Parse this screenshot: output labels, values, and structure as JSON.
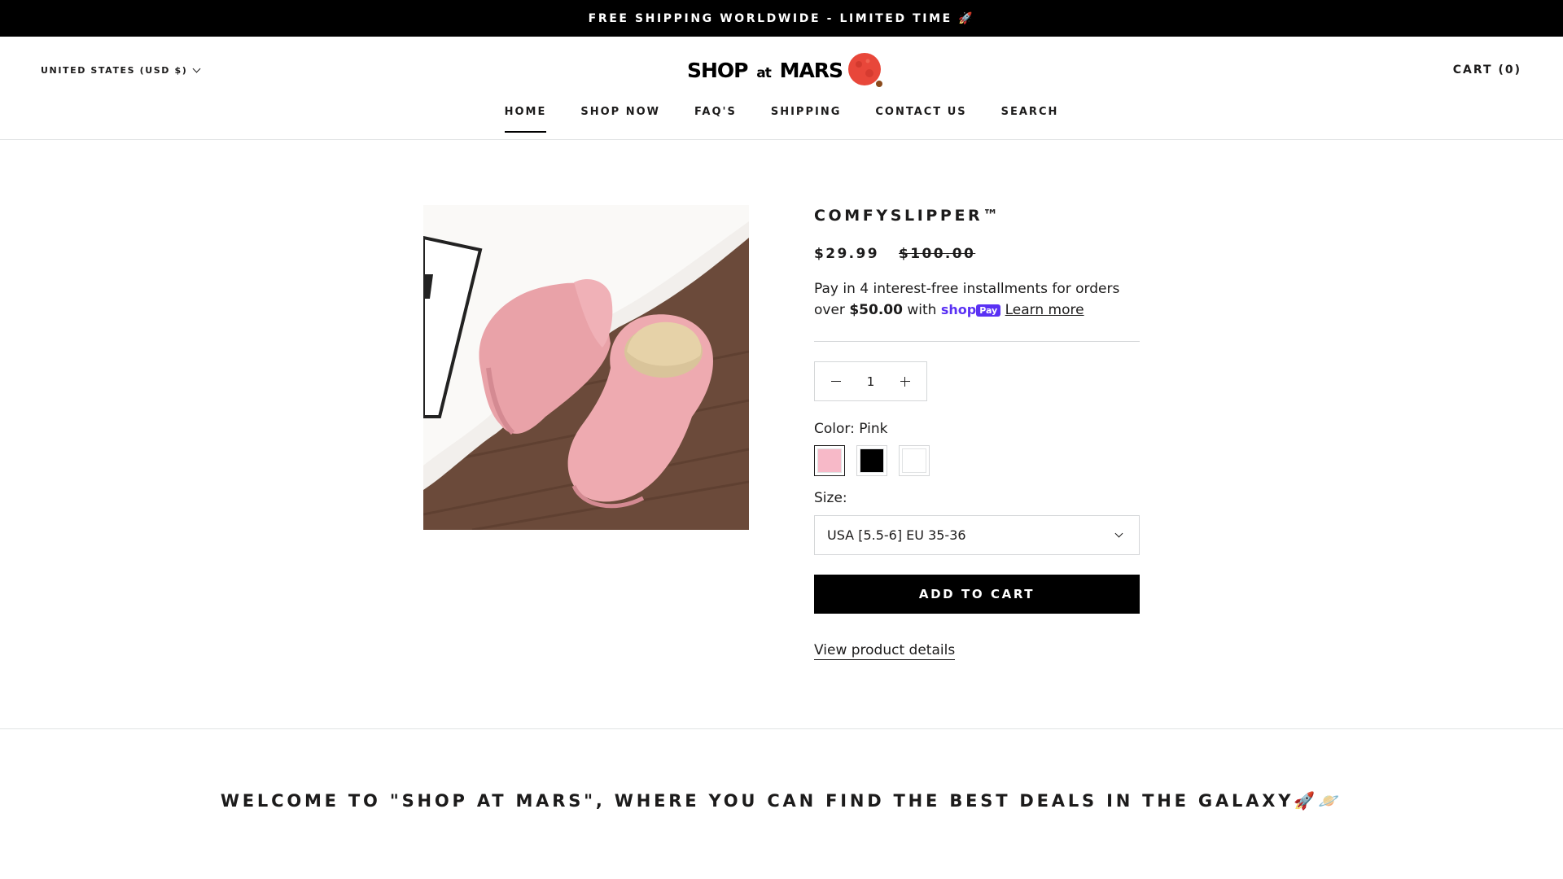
{
  "announcement": {
    "text": "FREE SHIPPING WORLDWIDE - LIMITED TIME 🚀"
  },
  "header": {
    "country": "UNITED STATES (USD $)",
    "logo_main": "SHOP",
    "logo_at": "at",
    "logo_end": "MARS",
    "cart": "CART (0)"
  },
  "nav": {
    "items": [
      {
        "label": "HOME",
        "active": true
      },
      {
        "label": "SHOP NOW"
      },
      {
        "label": "FAQ'S"
      },
      {
        "label": "SHIPPING"
      },
      {
        "label": "CONTACT US"
      },
      {
        "label": "SEARCH"
      }
    ]
  },
  "product": {
    "title": "COMFYSLIPPER™",
    "price": "$29.99",
    "compare_price": "$100.00",
    "installments_prefix": "Pay in 4 interest-free installments for orders over",
    "installments_amount": "$50.00",
    "installments_with": "with",
    "shoppay_word": "shop",
    "shoppay_badge": "Pay",
    "learn_more": "Learn more",
    "quantity": "1",
    "color_label": "Color: Pink",
    "colors": [
      {
        "name": "Pink",
        "hex": "#f7b9c8",
        "selected": true
      },
      {
        "name": "Black",
        "hex": "#000000"
      },
      {
        "name": "White",
        "hex": "#ffffff"
      }
    ],
    "size_label": "Size:",
    "size_selected": "USA [5.5-6] EU 35-36",
    "add_to_cart": "ADD TO CART",
    "view_details": "View product details"
  },
  "welcome": {
    "heading": "WELCOME TO \"SHOP AT MARS\", WHERE YOU CAN FIND THE BEST DEALS IN THE GALAXY🚀🪐"
  }
}
